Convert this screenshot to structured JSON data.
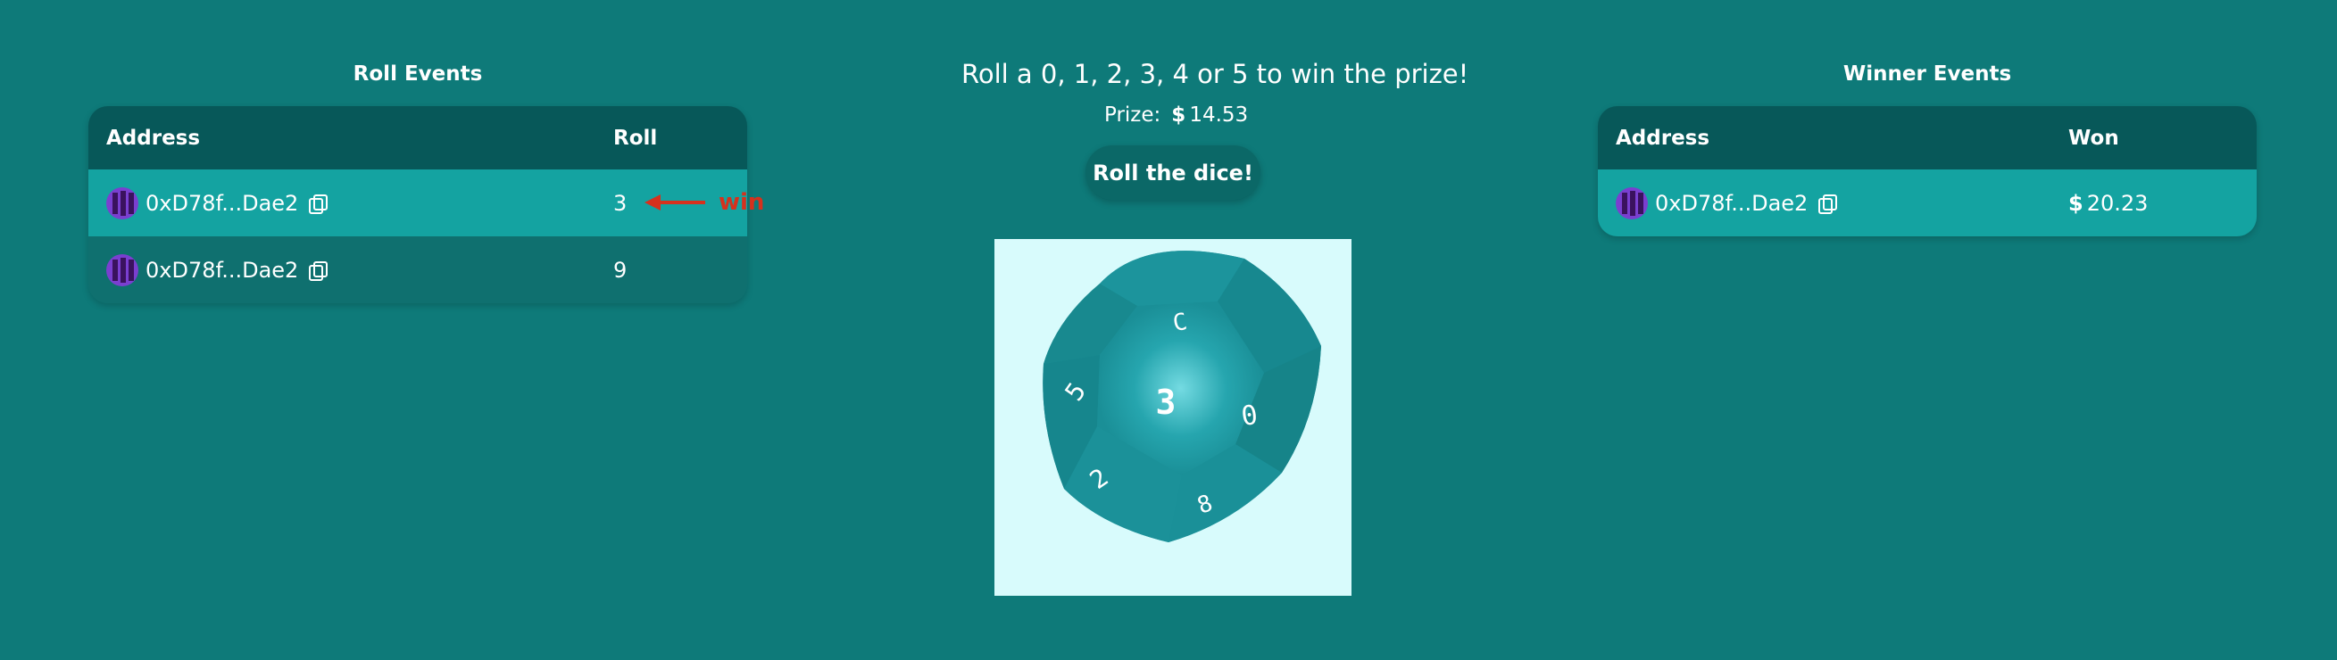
{
  "roll_events": {
    "title": "Roll Events",
    "columns": [
      "Address",
      "Roll"
    ],
    "rows": [
      {
        "address": "0xD78f...Dae2",
        "roll": "3",
        "highlight": true
      },
      {
        "address": "0xD78f...Dae2",
        "roll": "9",
        "highlight": false
      }
    ]
  },
  "game": {
    "instruction": "Roll a 0, 1, 2, 3, 4 or 5 to win the prize!",
    "prize_label": "Prize:",
    "prize_currency": "$",
    "prize_value": "14.53",
    "roll_button": "Roll the dice!",
    "dice_face_value": "3",
    "dice_visible_numbers": [
      "3",
      "0",
      "5",
      "2",
      "8",
      "C"
    ]
  },
  "winner_events": {
    "title": "Winner Events",
    "columns": [
      "Address",
      "Won"
    ],
    "rows": [
      {
        "address": "0xD78f...Dae2",
        "currency": "$",
        "won": "20.23"
      }
    ]
  },
  "annotation": {
    "text": "win",
    "color": "#d6311d"
  },
  "colors": {
    "background": "#0e7a79",
    "table_header": "#075859",
    "row_highlight": "#14a3a1",
    "row_plain": "#0f706f",
    "dice_canvas": "#d8fbfc",
    "dice": "#1a8f97"
  }
}
